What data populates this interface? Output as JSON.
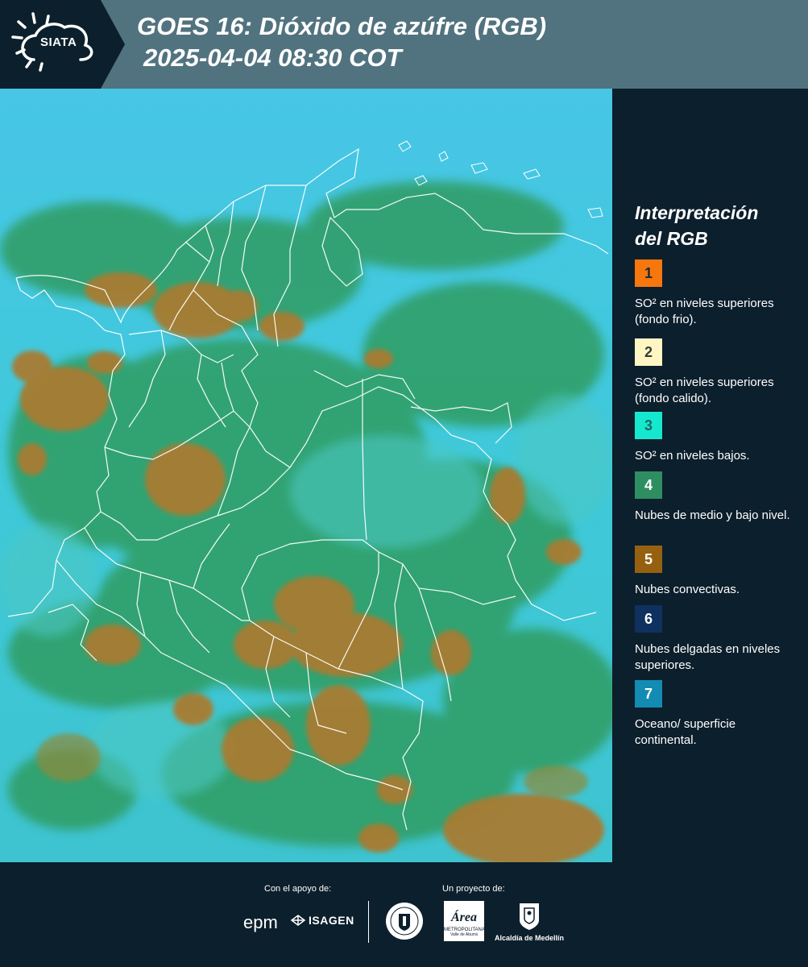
{
  "header": {
    "logo_text": "SIATA",
    "title": "GOES 16: Dióxido de azúfre (RGB)",
    "datetime": "2025-04-04 08:30 COT"
  },
  "legend": {
    "title_line1": "Interpretación",
    "title_line2": "del RGB",
    "items": [
      {
        "number": "1",
        "color": "#f7770f",
        "number_color": "#1c2a33",
        "label": "SO² en niveles superiores (fondo frio)."
      },
      {
        "number": "2",
        "color": "#fff6c4",
        "number_color": "#3b3b3b",
        "label": "SO² en niveles superiores (fondo calido)."
      },
      {
        "number": "3",
        "color": "#16e8cf",
        "number_color": "#1c6a63",
        "label": "SO² en niveles bajos."
      },
      {
        "number": "4",
        "color": "#2e8e62",
        "number_color": "#ffffff",
        "label": "Nubes de medio y bajo nivel."
      },
      {
        "number": "5",
        "color": "#956110",
        "number_color": "#ffffff",
        "label": "Nubes convectivas."
      },
      {
        "number": "6",
        "color": "#0f3160",
        "number_color": "#ffffff",
        "label": "Nubes delgadas en niveles superiores."
      },
      {
        "number": "7",
        "color": "#138bb2",
        "number_color": "#ffffff",
        "label": "Oceano/ superficie continental."
      }
    ]
  },
  "footer": {
    "support_label": "Con el apoyo de:",
    "project_label": "Un proyecto de:",
    "sponsors": {
      "epm": "epm",
      "isagen": "ISAGEN",
      "area_text": "Área",
      "area_sub1": "METROPOLITANA",
      "area_sub2": "Valle de Aburrá",
      "alcaldia": "Alcaldía de Medellín"
    }
  },
  "colors": {
    "header_bg": "#51737f",
    "background": "#0c1f2c",
    "map_ocean": "#36c7dd",
    "map_green": "#2f9a5a",
    "map_convective": "#a87b30"
  }
}
